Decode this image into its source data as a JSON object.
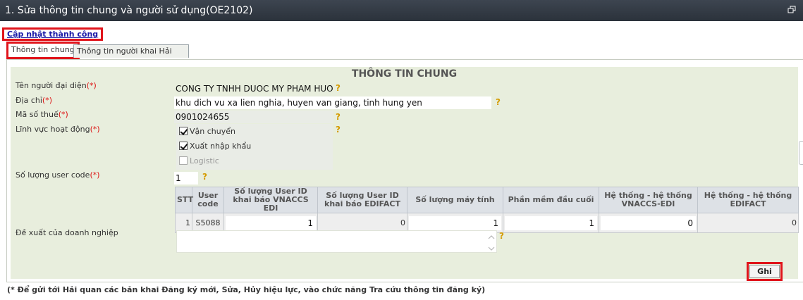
{
  "window": {
    "title": "1. Sửa thông tin chung và người sử dụng(OE2102)",
    "restore_icon": "restore-window-icon"
  },
  "status": {
    "message": "Cập nhật thành công"
  },
  "tabs": [
    {
      "label": "Thông tin chung",
      "active": true
    },
    {
      "label": "Thông tin người khai Hải quan",
      "active": false
    }
  ],
  "form": {
    "section_title": "THÔNG TIN CHUNG",
    "required_mark": "(*)",
    "help_mark": "?",
    "representative": {
      "label": "Tên người đại diện",
      "value": "CONG TY TNHH DUOC MY PHAM HUONG TRAM"
    },
    "address": {
      "label": "Địa chỉ",
      "value": "khu dich vu xa lien nghia, huyen van giang, tinh hung yen"
    },
    "tax_code": {
      "label": "Mã số thuế",
      "value": "0901024655"
    },
    "activity_fields": {
      "label": "Lĩnh vực hoạt động",
      "options": [
        {
          "label": "Vận chuyển",
          "checked": true,
          "disabled": false
        },
        {
          "label": "Xuất nhập khẩu",
          "checked": true,
          "disabled": false
        },
        {
          "label": "Logistic",
          "checked": false,
          "disabled": true
        }
      ]
    },
    "user_code_count": {
      "label": "Số lượng user code",
      "value": "1"
    },
    "proposal": {
      "label": "Đề xuất của doanh nghiệp",
      "value": ""
    }
  },
  "user_table": {
    "headers": [
      "STT",
      "User code",
      "Số lượng User ID khai báo VNACCS EDI",
      "Số lượng User ID khai báo EDIFACT",
      "Số lượng máy tính",
      "Phần mềm đầu cuối",
      "Hệ thống - hệ thống VNACCS-EDI",
      "Hệ thống - hệ thống EDIFACT"
    ],
    "rows": [
      {
        "stt": "1",
        "user_code": "S5088",
        "vnaccs_edi": "1",
        "edifact": "0",
        "computers": "1",
        "terminal_software": "1",
        "sys_vnaccs": "0",
        "sys_edifact": "0"
      }
    ]
  },
  "actions": {
    "save_label": "Ghi"
  },
  "footer": {
    "note": "(* Để gửi tới Hải quan các bản khai Đăng ký mới, Sửa, Hủy hiệu lực, vào chức năng Tra cứu thông tin đăng ký)"
  }
}
